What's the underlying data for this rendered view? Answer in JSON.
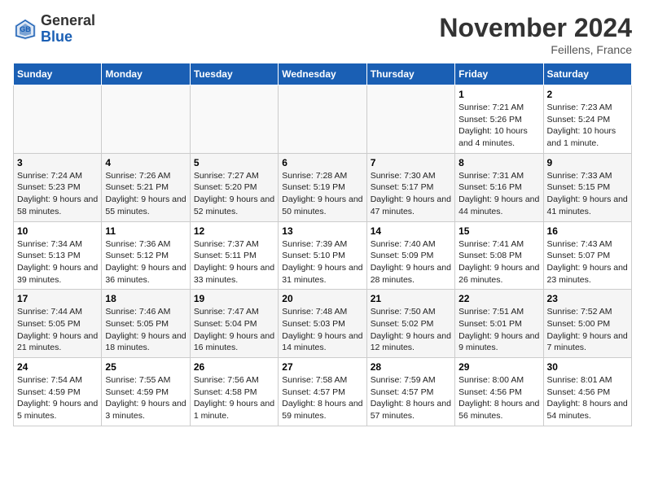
{
  "header": {
    "logo_general": "General",
    "logo_blue": "Blue",
    "month_title": "November 2024",
    "location": "Feillens, France"
  },
  "days_of_week": [
    "Sunday",
    "Monday",
    "Tuesday",
    "Wednesday",
    "Thursday",
    "Friday",
    "Saturday"
  ],
  "weeks": [
    [
      {
        "day": "",
        "empty": true
      },
      {
        "day": "",
        "empty": true
      },
      {
        "day": "",
        "empty": true
      },
      {
        "day": "",
        "empty": true
      },
      {
        "day": "",
        "empty": true
      },
      {
        "day": "1",
        "sunrise": "Sunrise: 7:21 AM",
        "sunset": "Sunset: 5:26 PM",
        "daylight": "Daylight: 10 hours and 4 minutes."
      },
      {
        "day": "2",
        "sunrise": "Sunrise: 7:23 AM",
        "sunset": "Sunset: 5:24 PM",
        "daylight": "Daylight: 10 hours and 1 minute."
      }
    ],
    [
      {
        "day": "3",
        "sunrise": "Sunrise: 7:24 AM",
        "sunset": "Sunset: 5:23 PM",
        "daylight": "Daylight: 9 hours and 58 minutes."
      },
      {
        "day": "4",
        "sunrise": "Sunrise: 7:26 AM",
        "sunset": "Sunset: 5:21 PM",
        "daylight": "Daylight: 9 hours and 55 minutes."
      },
      {
        "day": "5",
        "sunrise": "Sunrise: 7:27 AM",
        "sunset": "Sunset: 5:20 PM",
        "daylight": "Daylight: 9 hours and 52 minutes."
      },
      {
        "day": "6",
        "sunrise": "Sunrise: 7:28 AM",
        "sunset": "Sunset: 5:19 PM",
        "daylight": "Daylight: 9 hours and 50 minutes."
      },
      {
        "day": "7",
        "sunrise": "Sunrise: 7:30 AM",
        "sunset": "Sunset: 5:17 PM",
        "daylight": "Daylight: 9 hours and 47 minutes."
      },
      {
        "day": "8",
        "sunrise": "Sunrise: 7:31 AM",
        "sunset": "Sunset: 5:16 PM",
        "daylight": "Daylight: 9 hours and 44 minutes."
      },
      {
        "day": "9",
        "sunrise": "Sunrise: 7:33 AM",
        "sunset": "Sunset: 5:15 PM",
        "daylight": "Daylight: 9 hours and 41 minutes."
      }
    ],
    [
      {
        "day": "10",
        "sunrise": "Sunrise: 7:34 AM",
        "sunset": "Sunset: 5:13 PM",
        "daylight": "Daylight: 9 hours and 39 minutes."
      },
      {
        "day": "11",
        "sunrise": "Sunrise: 7:36 AM",
        "sunset": "Sunset: 5:12 PM",
        "daylight": "Daylight: 9 hours and 36 minutes."
      },
      {
        "day": "12",
        "sunrise": "Sunrise: 7:37 AM",
        "sunset": "Sunset: 5:11 PM",
        "daylight": "Daylight: 9 hours and 33 minutes."
      },
      {
        "day": "13",
        "sunrise": "Sunrise: 7:39 AM",
        "sunset": "Sunset: 5:10 PM",
        "daylight": "Daylight: 9 hours and 31 minutes."
      },
      {
        "day": "14",
        "sunrise": "Sunrise: 7:40 AM",
        "sunset": "Sunset: 5:09 PM",
        "daylight": "Daylight: 9 hours and 28 minutes."
      },
      {
        "day": "15",
        "sunrise": "Sunrise: 7:41 AM",
        "sunset": "Sunset: 5:08 PM",
        "daylight": "Daylight: 9 hours and 26 minutes."
      },
      {
        "day": "16",
        "sunrise": "Sunrise: 7:43 AM",
        "sunset": "Sunset: 5:07 PM",
        "daylight": "Daylight: 9 hours and 23 minutes."
      }
    ],
    [
      {
        "day": "17",
        "sunrise": "Sunrise: 7:44 AM",
        "sunset": "Sunset: 5:05 PM",
        "daylight": "Daylight: 9 hours and 21 minutes."
      },
      {
        "day": "18",
        "sunrise": "Sunrise: 7:46 AM",
        "sunset": "Sunset: 5:05 PM",
        "daylight": "Daylight: 9 hours and 18 minutes."
      },
      {
        "day": "19",
        "sunrise": "Sunrise: 7:47 AM",
        "sunset": "Sunset: 5:04 PM",
        "daylight": "Daylight: 9 hours and 16 minutes."
      },
      {
        "day": "20",
        "sunrise": "Sunrise: 7:48 AM",
        "sunset": "Sunset: 5:03 PM",
        "daylight": "Daylight: 9 hours and 14 minutes."
      },
      {
        "day": "21",
        "sunrise": "Sunrise: 7:50 AM",
        "sunset": "Sunset: 5:02 PM",
        "daylight": "Daylight: 9 hours and 12 minutes."
      },
      {
        "day": "22",
        "sunrise": "Sunrise: 7:51 AM",
        "sunset": "Sunset: 5:01 PM",
        "daylight": "Daylight: 9 hours and 9 minutes."
      },
      {
        "day": "23",
        "sunrise": "Sunrise: 7:52 AM",
        "sunset": "Sunset: 5:00 PM",
        "daylight": "Daylight: 9 hours and 7 minutes."
      }
    ],
    [
      {
        "day": "24",
        "sunrise": "Sunrise: 7:54 AM",
        "sunset": "Sunset: 4:59 PM",
        "daylight": "Daylight: 9 hours and 5 minutes."
      },
      {
        "day": "25",
        "sunrise": "Sunrise: 7:55 AM",
        "sunset": "Sunset: 4:59 PM",
        "daylight": "Daylight: 9 hours and 3 minutes."
      },
      {
        "day": "26",
        "sunrise": "Sunrise: 7:56 AM",
        "sunset": "Sunset: 4:58 PM",
        "daylight": "Daylight: 9 hours and 1 minute."
      },
      {
        "day": "27",
        "sunrise": "Sunrise: 7:58 AM",
        "sunset": "Sunset: 4:57 PM",
        "daylight": "Daylight: 8 hours and 59 minutes."
      },
      {
        "day": "28",
        "sunrise": "Sunrise: 7:59 AM",
        "sunset": "Sunset: 4:57 PM",
        "daylight": "Daylight: 8 hours and 57 minutes."
      },
      {
        "day": "29",
        "sunrise": "Sunrise: 8:00 AM",
        "sunset": "Sunset: 4:56 PM",
        "daylight": "Daylight: 8 hours and 56 minutes."
      },
      {
        "day": "30",
        "sunrise": "Sunrise: 8:01 AM",
        "sunset": "Sunset: 4:56 PM",
        "daylight": "Daylight: 8 hours and 54 minutes."
      }
    ]
  ]
}
